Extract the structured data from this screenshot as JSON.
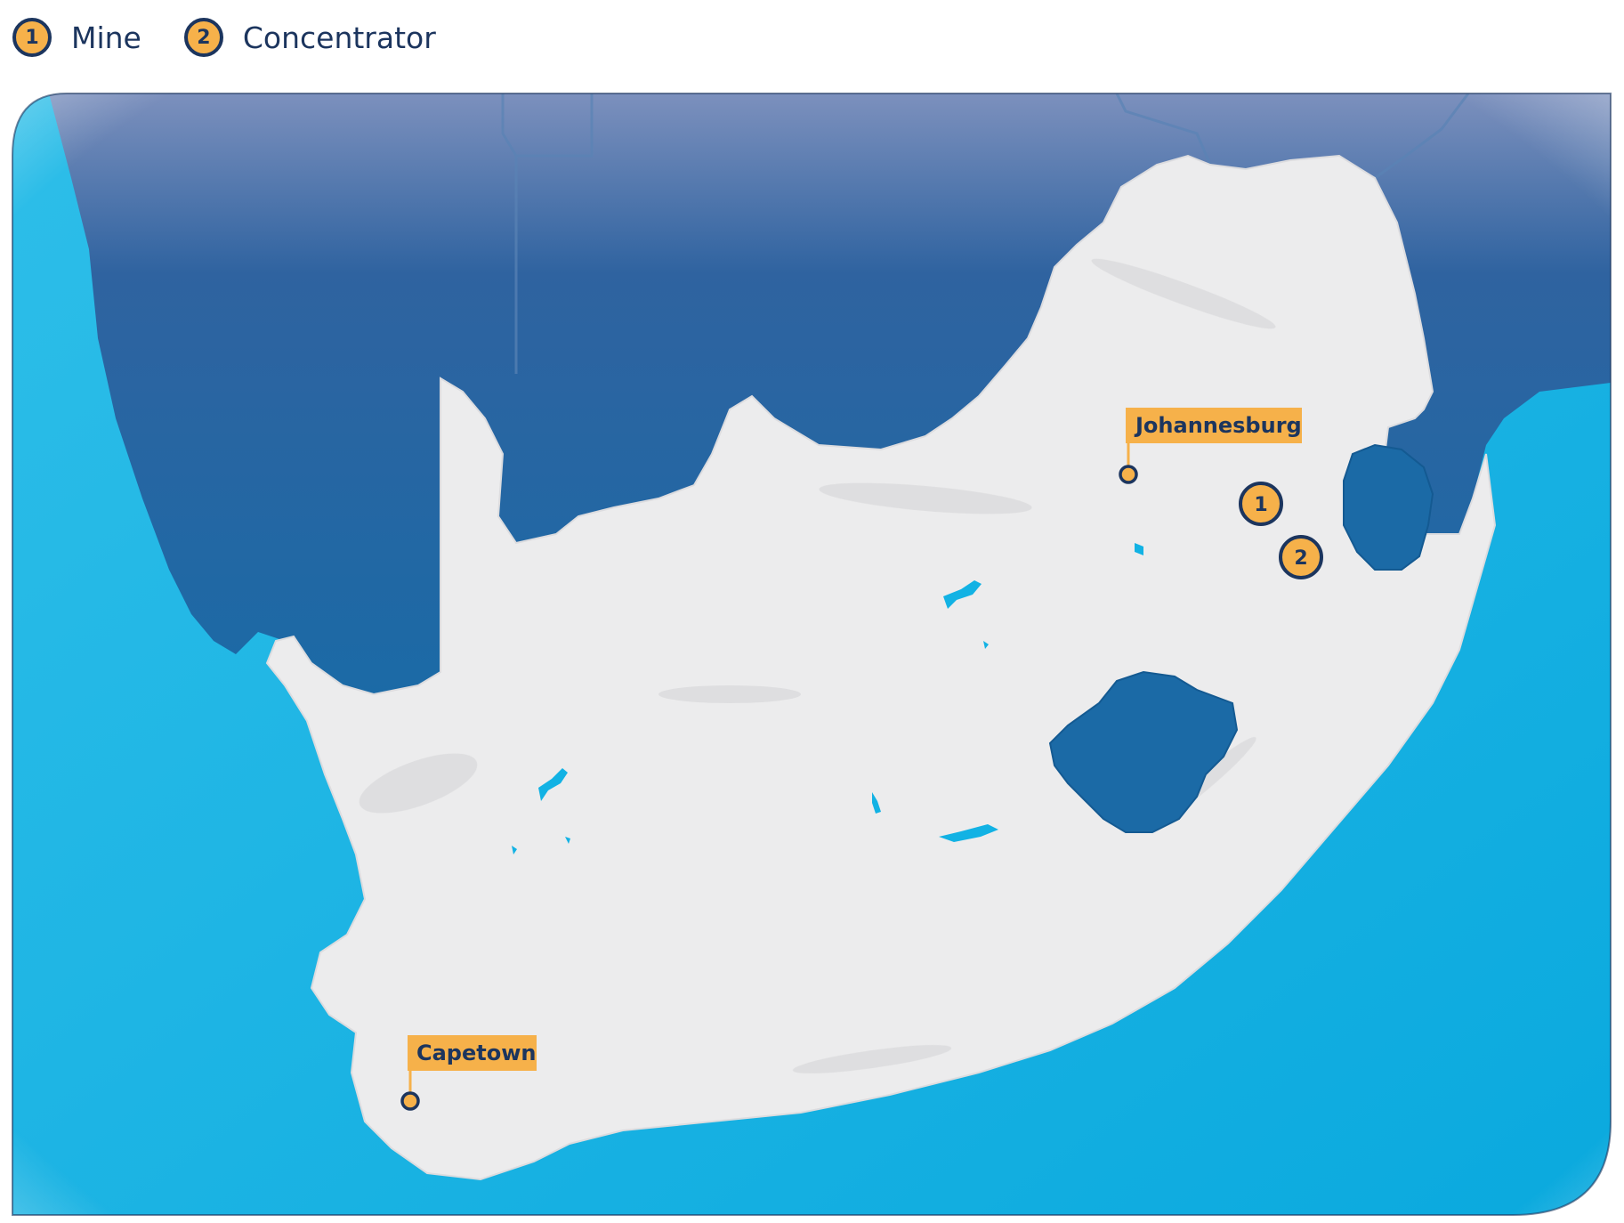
{
  "legend": {
    "items": [
      {
        "number": "1",
        "label": "Mine"
      },
      {
        "number": "2",
        "label": "Concentrator"
      }
    ]
  },
  "map": {
    "cities": [
      {
        "id": "johannesburg",
        "name": "Johannesburg"
      },
      {
        "id": "capetown",
        "name": "Capetown"
      }
    ],
    "sites": [
      {
        "id": "mine",
        "number": "1"
      },
      {
        "id": "concentrator",
        "number": "2"
      }
    ]
  },
  "colors": {
    "ocean": "#12b2e4",
    "neighbour_countries": "#1b6aa6",
    "frame_top": "#7f93bf",
    "land": "#ececed",
    "marker_fill": "#f6b14a",
    "outline": "#1c355e"
  }
}
